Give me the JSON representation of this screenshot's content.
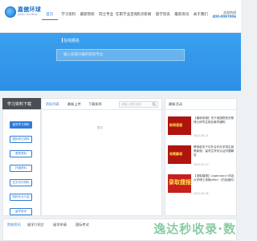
{
  "brand": {
    "name": "嘉傲环球",
    "sub": "JIAAO GLOBAL"
  },
  "nav": {
    "items": [
      "首页",
      "学习资料",
      "最新院校",
      "院士专业",
      "在职学业咨询",
      "热点新闻",
      "留学资讯",
      "最新资讯",
      "关于我们"
    ],
    "active_index": 0
  },
  "hotline": {
    "label": "咨询热线",
    "number": "400-0097006"
  },
  "hero": {
    "title": "在线报名",
    "search_placeholder": "输入您感兴趣的院校专业"
  },
  "left_panel": {
    "title": "学习资料下载",
    "items": [
      "留学学习资料",
      "国际考试资料",
      "雅思资料",
      "托福资料",
      "论文写作资料",
      "院校专业介绍",
      "留学资讯"
    ],
    "active_index": 0
  },
  "middle_panel": {
    "tabs": [
      "资料列表",
      "最新上传",
      "下载排序"
    ],
    "active_index": 0,
    "search_placeholder": "请输入资料名称",
    "empty_text": "暂无"
  },
  "right_panel": {
    "title": "最新活动",
    "news": [
      {
        "thumb": "新闻速递",
        "title": "【最新快报】关于英国院校在职博士研究生报名事项通知",
        "date": "2022-06-14",
        "style": "dark"
      },
      {
        "thumb": "政策解读",
        "title": "教育部关于中外合作办学招生政策新规，留学生学历认证问题解答",
        "date": "2022-05-10",
        "style": "dark"
      },
      {
        "thumb": "录取捷报",
        "title": "【录取捷报】Legendary! 科技大学博士录取offer!（内含福利）",
        "date": "2022-05-08",
        "style": "bold"
      }
    ]
  },
  "bottom_strip": {
    "tabs": [
      "院校资讯",
      "留学介绍主",
      "留学申请",
      "国际考试"
    ],
    "active_index": 0,
    "watermark": "逸达秒收录·数"
  },
  "colors": {
    "accent": "#2f7cd6",
    "hero_bg": "#3aa0ef",
    "news_red": "#c7201d",
    "dark_head": "#4a4f55"
  }
}
